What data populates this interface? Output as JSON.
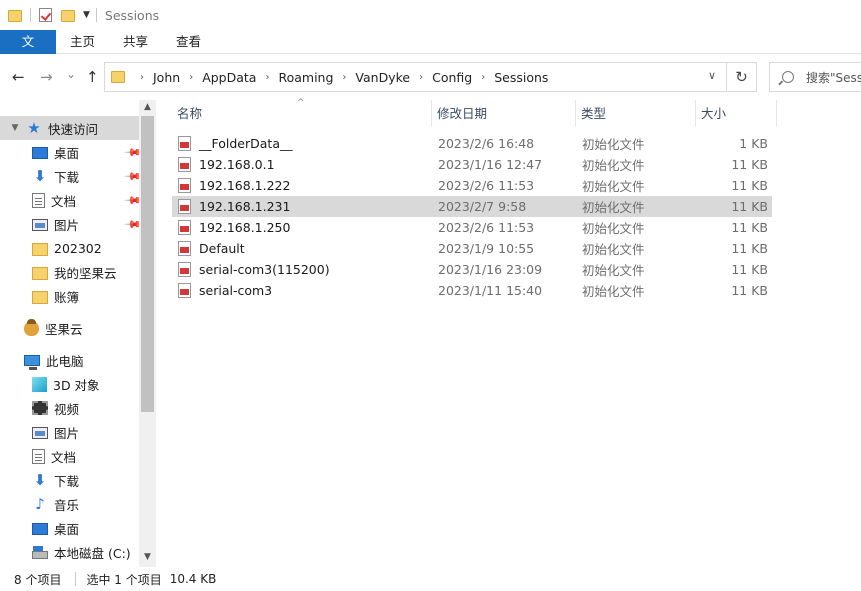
{
  "window": {
    "title": "Sessions"
  },
  "ribbon": {
    "tabs": [
      "文件",
      "主页",
      "共享",
      "查看"
    ]
  },
  "nav": {
    "back": "←",
    "forward": "→",
    "recent": "⌄",
    "up": "↑",
    "breadcrumb": [
      "John",
      "AppData",
      "Roaming",
      "VanDyke",
      "Config",
      "Sessions"
    ],
    "refresh": "↻",
    "search_placeholder": "搜索\"Sessions\""
  },
  "sidebar": {
    "quick_access": "快速访问",
    "items": [
      {
        "label": "快速访问",
        "icon": "star-icon"
      },
      {
        "label": "桌面",
        "icon": "desktop-icon",
        "pinned": true
      },
      {
        "label": "下载",
        "icon": "download-icon",
        "pinned": true
      },
      {
        "label": "文档",
        "icon": "document-icon",
        "pinned": true
      },
      {
        "label": "图片",
        "icon": "picture-icon",
        "pinned": true
      },
      {
        "label": "202302",
        "icon": "folder-icon"
      },
      {
        "label": "我的坚果云",
        "icon": "folder-icon"
      },
      {
        "label": "账簿",
        "icon": "folder-icon"
      },
      {
        "label": "坚果云",
        "icon": "nutstore-icon"
      },
      {
        "label": "此电脑",
        "icon": "computer-icon"
      },
      {
        "label": "3D 对象",
        "icon": "3d-objects-icon"
      },
      {
        "label": "视频",
        "icon": "video-icon"
      },
      {
        "label": "图片",
        "icon": "picture-icon"
      },
      {
        "label": "文档",
        "icon": "document-icon"
      },
      {
        "label": "下载",
        "icon": "download-icon"
      },
      {
        "label": "音乐",
        "icon": "music-icon"
      },
      {
        "label": "桌面",
        "icon": "desktop-icon"
      },
      {
        "label": "本地磁盘 (C:)",
        "icon": "disk-icon"
      }
    ]
  },
  "columns": {
    "name": "名称",
    "date": "修改日期",
    "type": "类型",
    "size": "大小"
  },
  "files": [
    {
      "name": "__FolderData__",
      "date": "2023/2/6 16:48",
      "type": "初始化文件",
      "size": "1 KB"
    },
    {
      "name": "192.168.0.1",
      "date": "2023/1/16 12:47",
      "type": "初始化文件",
      "size": "11 KB"
    },
    {
      "name": "192.168.1.222",
      "date": "2023/2/6 11:53",
      "type": "初始化文件",
      "size": "11 KB"
    },
    {
      "name": "192.168.1.231",
      "date": "2023/2/7 9:58",
      "type": "初始化文件",
      "size": "11 KB",
      "selected": true
    },
    {
      "name": "192.168.1.250",
      "date": "2023/2/6 11:53",
      "type": "初始化文件",
      "size": "11 KB"
    },
    {
      "name": "Default",
      "date": "2023/1/9 10:55",
      "type": "初始化文件",
      "size": "11 KB"
    },
    {
      "name": "serial-com3(115200)",
      "date": "2023/1/16 23:09",
      "type": "初始化文件",
      "size": "11 KB"
    },
    {
      "name": "serial-com3",
      "date": "2023/1/11 15:40",
      "type": "初始化文件",
      "size": "11 KB"
    }
  ],
  "status": {
    "count": "8 个项目",
    "selected": "选中 1 个项目",
    "size": "10.4 KB"
  }
}
